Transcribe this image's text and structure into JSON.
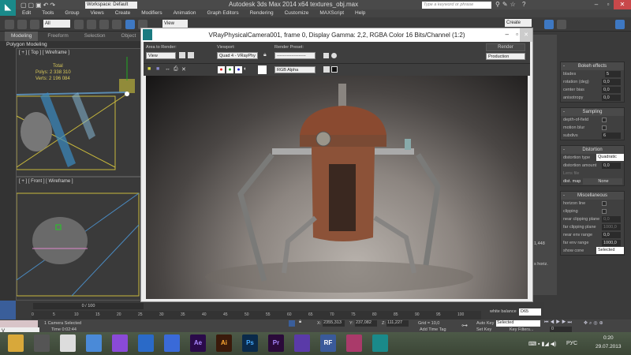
{
  "app": {
    "title": "Autodesk 3ds Max  2014 x64     textures_obj.max",
    "workspace": "Workspace: Default",
    "search_placeholder": "Type a keyword or phrase"
  },
  "menu": [
    "Edit",
    "Tools",
    "Group",
    "Views",
    "Create",
    "Modifiers",
    "Animation",
    "Graph Editors",
    "Rendering",
    "Customize",
    "MAXScript",
    "Help"
  ],
  "toolbar": {
    "filter": "All",
    "ref_coord": "View",
    "selection_set": "Create Selection Se"
  },
  "ribbon": {
    "tabs": [
      "Modeling",
      "Freeform",
      "Selection",
      "Object Pa"
    ],
    "panel": "Polygon Modeling"
  },
  "viewports": {
    "top_label": "[ + ] [ Top ] [ Wireframe ]",
    "front_label": "[ + ] [ Front ] [ Wireframe ]",
    "stats_title": "Total",
    "polys_label": "Polys:",
    "polys": "2 338 310",
    "verts_label": "Verts:",
    "verts": "2 196 084"
  },
  "frame": {
    "title": "VRayPhysicalCamera001, frame 0, Display Gamma: 2,2, RGBA Color 16 Bits/Channel (1:2)",
    "area_label": "Area to Render:",
    "area": "View",
    "viewport_label": "Viewport:",
    "viewport": "Quad 4 - VRayPhy",
    "preset_label": "Render Preset:",
    "preset": "--------------------",
    "render": "Render",
    "production": "Production",
    "channel": "RGB Alpha"
  },
  "rollouts": {
    "bokeh": {
      "title": "Bokeh effects",
      "rows": [
        {
          "l": "blades",
          "v": "5"
        },
        {
          "l": "rotation (deg)",
          "v": "0,0"
        },
        {
          "l": "center bias",
          "v": "0,0"
        },
        {
          "l": "anisotropy",
          "v": "0,0"
        }
      ]
    },
    "sampling": {
      "title": "Sampling",
      "dof": "depth-of-field",
      "motion": "motion blur",
      "subdivs": "subdivs",
      "subdivs_v": "6"
    },
    "distortion": {
      "title": "Distortion",
      "type_l": "distortion type",
      "type_v": "Quadratic",
      "amount_l": "distortion amount",
      "amount_v": "0,0",
      "lens": "Lens file",
      "map": "dist. map",
      "map_v": "None"
    },
    "misc": {
      "title": "Miscellaneous",
      "horizon": "horizon line",
      "clipping": "clipping",
      "near_clip": "near clipping plane",
      "near_clip_v": "0,0",
      "far_clip": "far clipping plane",
      "far_clip_v": "1000,0",
      "near_env": "near env range",
      "near_env_v": "0,0",
      "far_env": "far env range",
      "far_env_v": "1000,0",
      "cone": "show cone",
      "cone_v": "Selected"
    }
  },
  "midpanel": {
    "white_balance": "white balance",
    "wb_value": "D65",
    "value_1448": "1,448",
    "horiz": "s horiz."
  },
  "timeline": {
    "frame": "0 / 100",
    "ticks": [
      "0",
      "5",
      "10",
      "15",
      "20",
      "25",
      "30",
      "35",
      "40",
      "45",
      "50",
      "55",
      "60",
      "65",
      "70",
      "75",
      "80",
      "85",
      "90",
      "95",
      "100"
    ]
  },
  "status": {
    "selected": "1 Camera Selected",
    "time": "Time  0:02:44",
    "x_label": "X:",
    "x": "2355,313",
    "y_label": "Y:",
    "y": "237,082",
    "z_label": "Z:",
    "z": "111,227",
    "grid": "Grid = 10,0",
    "add_time_tag": "Add Time Tag",
    "auto_key": "Auto Key",
    "set_key": "Set Key",
    "key_mode": "Selected",
    "key_filters": "Key Filters...",
    "frame_field": "0",
    "mini": "V_"
  },
  "taskbar": {
    "apps": [
      "Explorer",
      "3ds",
      "Chrome",
      "App",
      "VS",
      "Cinema4D",
      "Save",
      "Ae",
      "Ai",
      "Ps",
      "Pr",
      "App2",
      "RF",
      "App3",
      "3dsMax"
    ],
    "lang": "РУС",
    "clock": "0:20",
    "date": "29.07.2013"
  }
}
